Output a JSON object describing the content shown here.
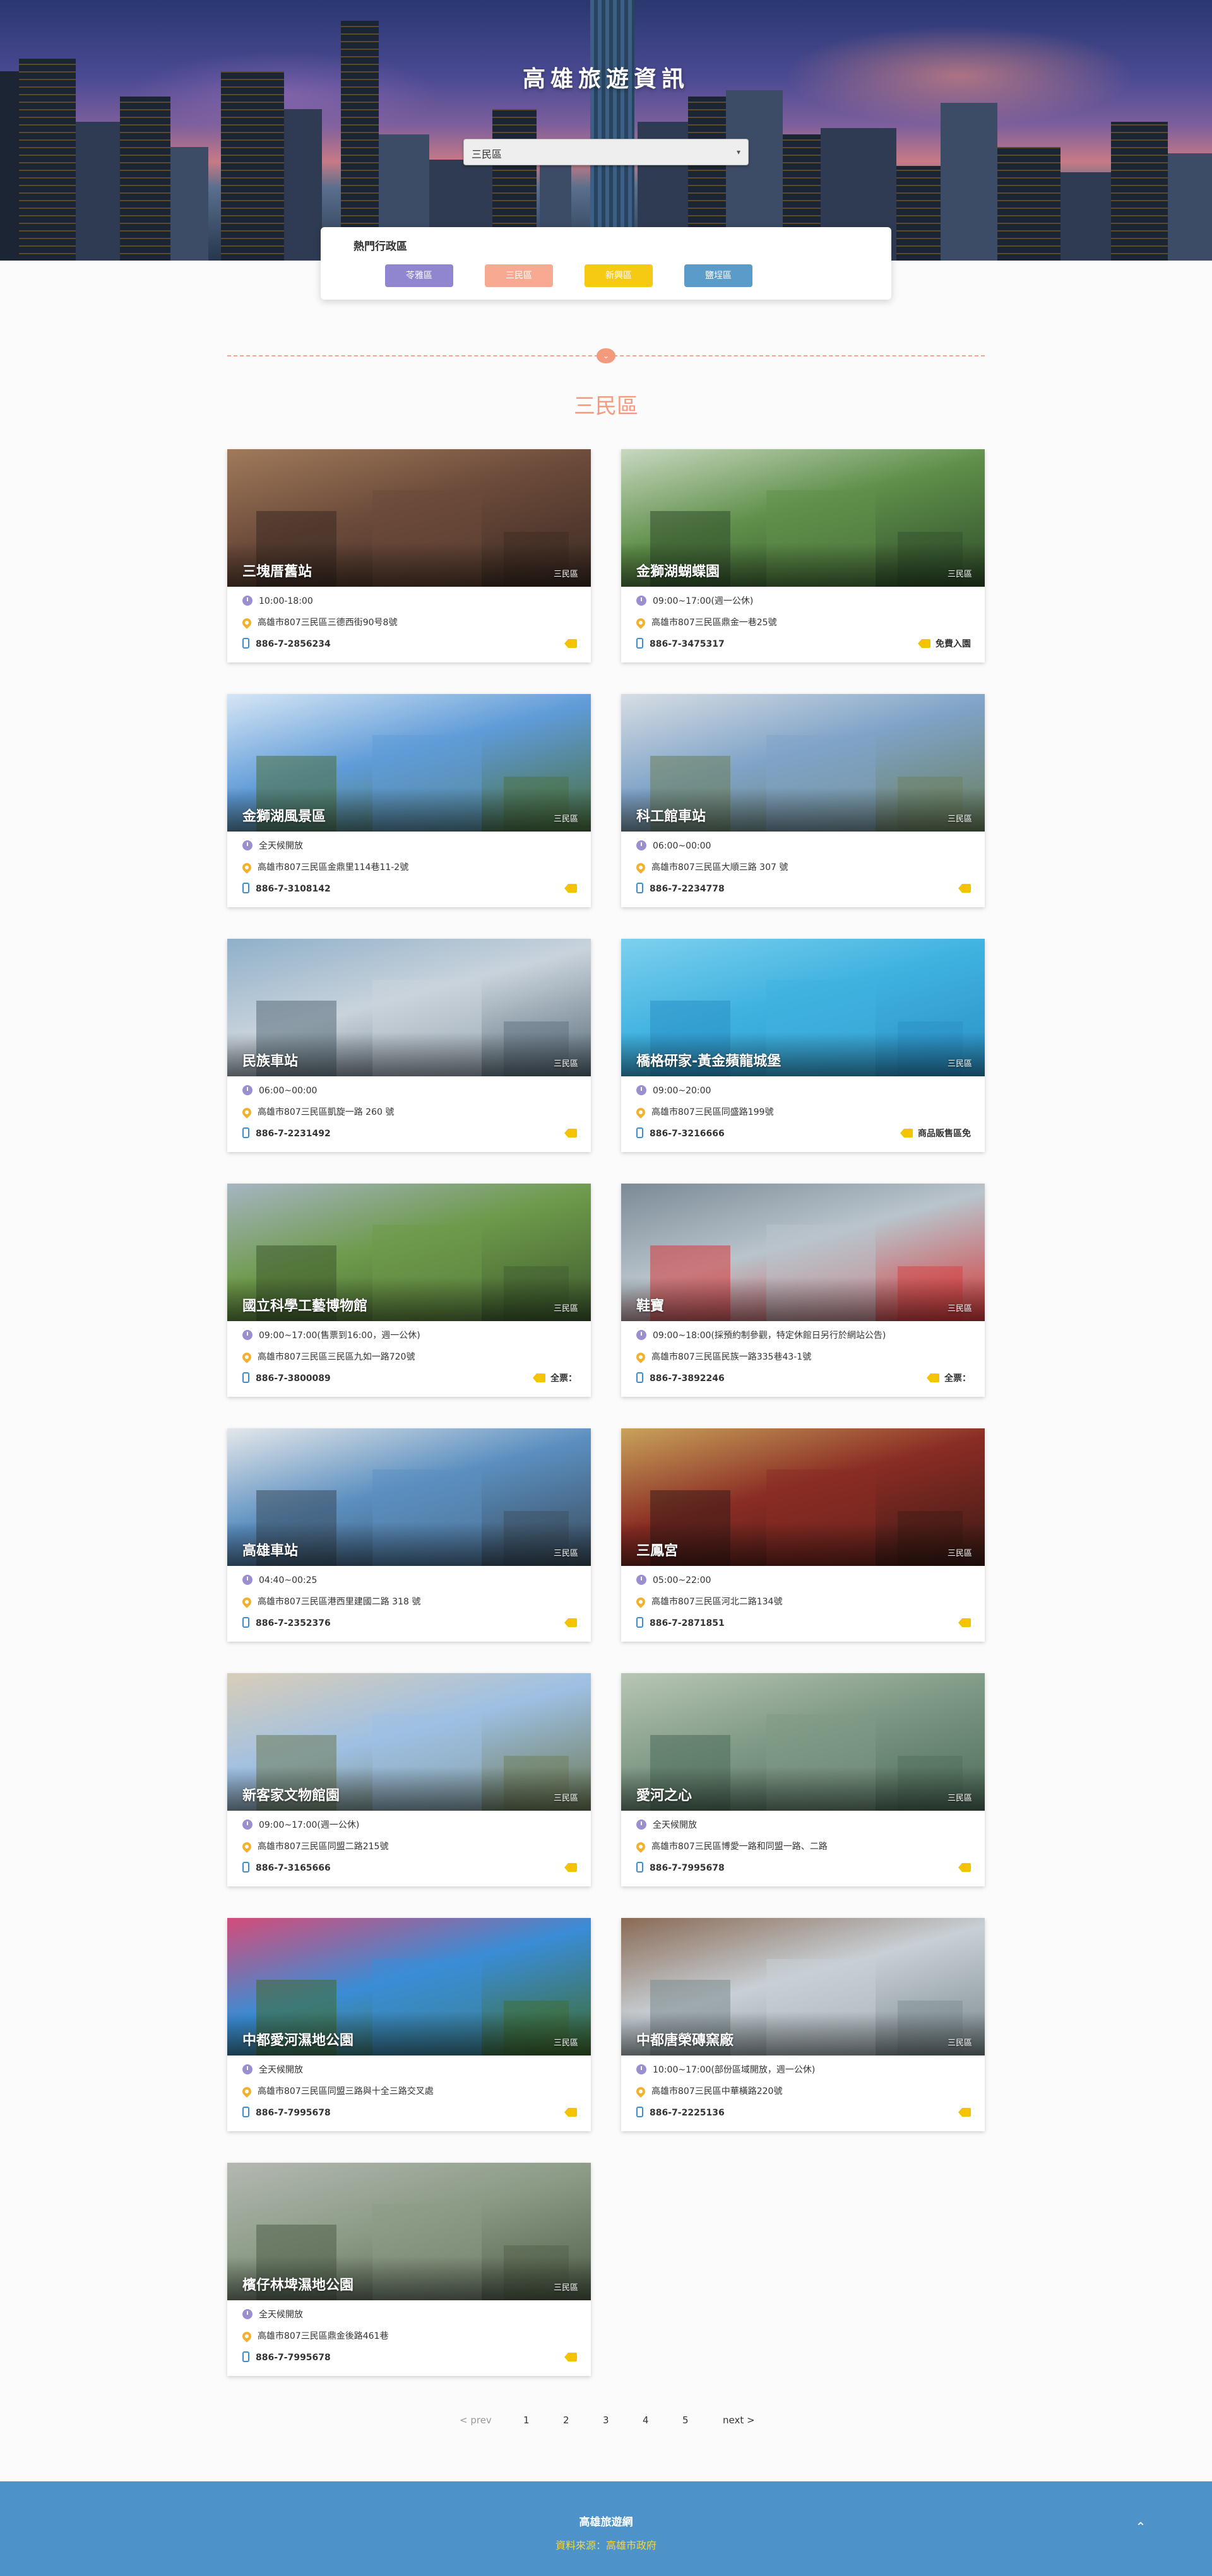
{
  "hero": {
    "title": "高雄旅遊資訊",
    "select_value": "三民區"
  },
  "hot_zones": {
    "title": "熱門行政區",
    "pills": [
      {
        "label": "苓雅區",
        "color": "#8f86cf"
      },
      {
        "label": "三民區",
        "color": "#f7a991"
      },
      {
        "label": "新興區",
        "color": "#f6c913"
      },
      {
        "label": "鹽埕區",
        "color": "#5b9bc9"
      }
    ]
  },
  "section": {
    "title": "三民區"
  },
  "cards": [
    {
      "name": "三塊厝舊站",
      "zone": "三民區",
      "hours": "10:00-18:00",
      "address": "高雄市807三民區三德西街90号8號",
      "phone": "886-7-2856234",
      "ticket": ""
    },
    {
      "name": "金獅湖蝴蝶園",
      "zone": "三民區",
      "hours": "09:00~17:00(週一公休)",
      "address": "高雄市807三民區鼎金一巷25號",
      "phone": "886-7-3475317",
      "ticket": "免費入園"
    },
    {
      "name": "金獅湖風景區",
      "zone": "三民區",
      "hours": "全天候開放",
      "address": "高雄市807三民區金鼎里114巷11-2號",
      "phone": "886-7-3108142",
      "ticket": ""
    },
    {
      "name": "科工館車站",
      "zone": "三民區",
      "hours": "06:00~00:00",
      "address": "高雄市807三民區大順三路 307 號",
      "phone": "886-7-2234778",
      "ticket": ""
    },
    {
      "name": "民族車站",
      "zone": "三民區",
      "hours": "06:00~00:00",
      "address": "高雄市807三民區凱旋一路 260 號",
      "phone": "886-7-2231492",
      "ticket": ""
    },
    {
      "name": "橋格研家-黃金蘋龍城堡",
      "zone": "三民區",
      "hours": "09:00~20:00",
      "address": "高雄市807三民區同盛路199號",
      "phone": "886-7-3216666",
      "ticket": "商品販售區免"
    },
    {
      "name": "國立科學工藝博物館",
      "zone": "三民區",
      "hours": "09:00~17:00(售票到16:00，週一公休)",
      "address": "高雄市807三民區三民區九如一路720號",
      "phone": "886-7-3800089",
      "ticket": "全票："
    },
    {
      "name": "鞋寶",
      "zone": "三民區",
      "hours": "09:00~18:00(採預約制參觀，特定休館日另行於網站公告)",
      "address": "高雄市807三民區民族一路335巷43-1號",
      "phone": "886-7-3892246",
      "ticket": "全票："
    },
    {
      "name": "高雄車站",
      "zone": "三民區",
      "hours": "04:40~00:25",
      "address": "高雄市807三民區港西里建國二路 318 號",
      "phone": "886-7-2352376",
      "ticket": ""
    },
    {
      "name": "三鳳宮",
      "zone": "三民區",
      "hours": "05:00~22:00",
      "address": "高雄市807三民區河北二路134號",
      "phone": "886-7-2871851",
      "ticket": ""
    },
    {
      "name": "新客家文物館園",
      "zone": "三民區",
      "hours": "09:00~17:00(週一公休)",
      "address": "高雄市807三民區同盟二路215號",
      "phone": "886-7-3165666",
      "ticket": ""
    },
    {
      "name": "愛河之心",
      "zone": "三民區",
      "hours": "全天候開放",
      "address": "高雄市807三民區博愛一路和同盟一路、二路",
      "phone": "886-7-7995678",
      "ticket": ""
    },
    {
      "name": "中都愛河濕地公園",
      "zone": "三民區",
      "hours": "全天候開放",
      "address": "高雄市807三民區同盟三路與十全三路交叉處",
      "phone": "886-7-7995678",
      "ticket": ""
    },
    {
      "name": "中都唐榮磚窯廠",
      "zone": "三民區",
      "hours": "10:00~17:00(部份區域開放，週一公休)",
      "address": "高雄市807三民區中華橫路220號",
      "phone": "886-7-2225136",
      "ticket": ""
    },
    {
      "name": "檳仔林埤濕地公園",
      "zone": "三民區",
      "hours": "全天候開放",
      "address": "高雄市807三民區鼎金後路461巷",
      "phone": "886-7-7995678",
      "ticket": ""
    }
  ],
  "pagination": {
    "prev": "< prev",
    "pages": [
      "1",
      "2",
      "3",
      "4",
      "5"
    ],
    "next": "next >"
  },
  "footer": {
    "title": "高雄旅遊網",
    "source": "資料來源：高雄市政府",
    "top_icon": "double-chevron-up-icon"
  }
}
